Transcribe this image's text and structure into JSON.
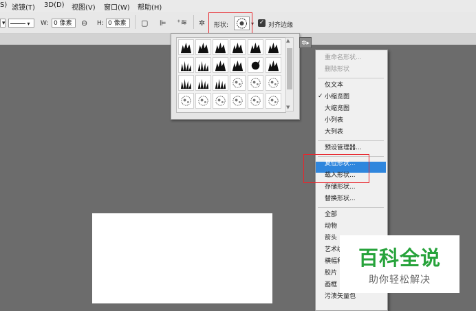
{
  "menubar": {
    "items": [
      "S)",
      "滤镜(T)",
      "3D(D)",
      "视图(V)",
      "窗口(W)",
      "帮助(H)"
    ]
  },
  "options": {
    "w_label": "W:",
    "w_value": "0 像素",
    "link_icon": "link-icon",
    "h_label": "H:",
    "h_value": "0 像素",
    "shape_label": "形状:",
    "align_edges": "对齐边缘",
    "align_checked": true
  },
  "menu": {
    "items": [
      {
        "label": "重命名形状...",
        "disabled": true
      },
      {
        "label": "删除形状",
        "disabled": true
      },
      {
        "sep": true
      },
      {
        "label": "仅文本"
      },
      {
        "label": "小缩览图",
        "checked": true
      },
      {
        "label": "大缩览图"
      },
      {
        "label": "小列表"
      },
      {
        "label": "大列表"
      },
      {
        "sep": true
      },
      {
        "label": "预设管理器..."
      },
      {
        "sep": true
      },
      {
        "label": "复位形状...",
        "highlighted": true
      },
      {
        "label": "载入形状..."
      },
      {
        "label": "存储形状..."
      },
      {
        "label": "替换形状..."
      },
      {
        "sep": true
      },
      {
        "label": "全部"
      },
      {
        "label": "动物"
      },
      {
        "label": "箭头"
      },
      {
        "label": "艺术纹理"
      },
      {
        "label": "横幅和奖品"
      },
      {
        "label": "胶片"
      },
      {
        "label": "画框"
      },
      {
        "label": "污渍矢量包"
      }
    ]
  },
  "checkmark": "✓",
  "watermark": {
    "title": "百科全说",
    "subtitle": "助你轻松解决"
  },
  "colors": {
    "highlight": "#2f86dd",
    "red_box": "#e8262d",
    "watermark_green": "#27a33b"
  }
}
